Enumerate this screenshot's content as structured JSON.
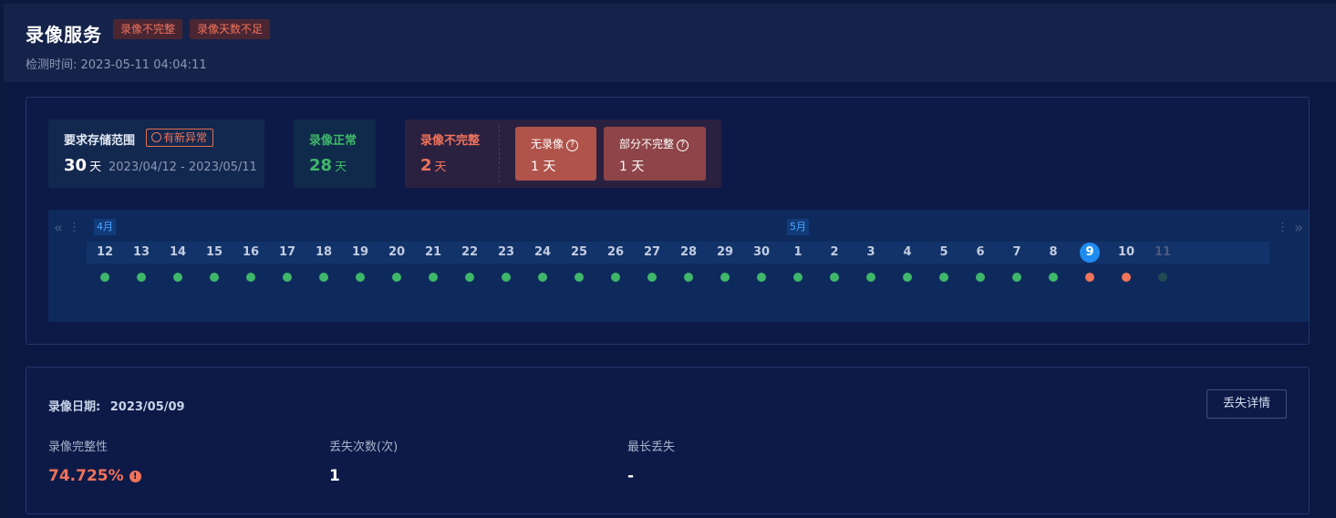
{
  "header": {
    "title": "录像服务",
    "tags": [
      "录像不完整",
      "录像天数不足"
    ],
    "check_time_label": "检测时间:",
    "check_time": "2023-05-11 04:04:11"
  },
  "summary": {
    "storage": {
      "label": "要求存储范围",
      "badge": "有新异常",
      "days": "30",
      "unit": "天",
      "range": "2023/04/12 - 2023/05/11"
    },
    "normal": {
      "label": "录像正常",
      "days": "28",
      "unit": "天"
    },
    "incomplete": {
      "label": "录像不完整",
      "days": "2",
      "unit": "天",
      "no_recording": {
        "label": "无录像",
        "value": "1 天"
      },
      "partial": {
        "label": "部分不完整",
        "value": "1 天"
      }
    }
  },
  "timeline": {
    "months": [
      {
        "label": "4月",
        "index": 0
      },
      {
        "label": "5月",
        "index": 19
      }
    ],
    "days": [
      {
        "d": "12",
        "status": "ok"
      },
      {
        "d": "13",
        "status": "ok"
      },
      {
        "d": "14",
        "status": "ok"
      },
      {
        "d": "15",
        "status": "ok"
      },
      {
        "d": "16",
        "status": "ok"
      },
      {
        "d": "17",
        "status": "ok"
      },
      {
        "d": "18",
        "status": "ok"
      },
      {
        "d": "19",
        "status": "ok"
      },
      {
        "d": "20",
        "status": "ok"
      },
      {
        "d": "21",
        "status": "ok"
      },
      {
        "d": "22",
        "status": "ok"
      },
      {
        "d": "23",
        "status": "ok"
      },
      {
        "d": "24",
        "status": "ok"
      },
      {
        "d": "25",
        "status": "ok"
      },
      {
        "d": "26",
        "status": "ok"
      },
      {
        "d": "27",
        "status": "ok"
      },
      {
        "d": "28",
        "status": "ok"
      },
      {
        "d": "29",
        "status": "ok"
      },
      {
        "d": "30",
        "status": "ok"
      },
      {
        "d": "1",
        "status": "ok"
      },
      {
        "d": "2",
        "status": "ok"
      },
      {
        "d": "3",
        "status": "ok"
      },
      {
        "d": "4",
        "status": "ok"
      },
      {
        "d": "5",
        "status": "ok"
      },
      {
        "d": "6",
        "status": "ok"
      },
      {
        "d": "7",
        "status": "ok"
      },
      {
        "d": "8",
        "status": "ok"
      },
      {
        "d": "9",
        "status": "bad",
        "selected": true
      },
      {
        "d": "10",
        "status": "bad"
      },
      {
        "d": "11",
        "status": "future"
      }
    ],
    "colors": {
      "ok": "#3fb76a",
      "bad": "#f0735a",
      "future": "#1f4a52"
    }
  },
  "detail": {
    "date_label": "录像日期:",
    "date": "2023/05/09",
    "button": "丢失详情",
    "integrity_label": "录像完整性",
    "integrity_value": "74.725%",
    "loss_count_label": "丢失次数(次)",
    "loss_count_value": "1",
    "longest_label": "最长丢失",
    "longest_value": "-"
  }
}
